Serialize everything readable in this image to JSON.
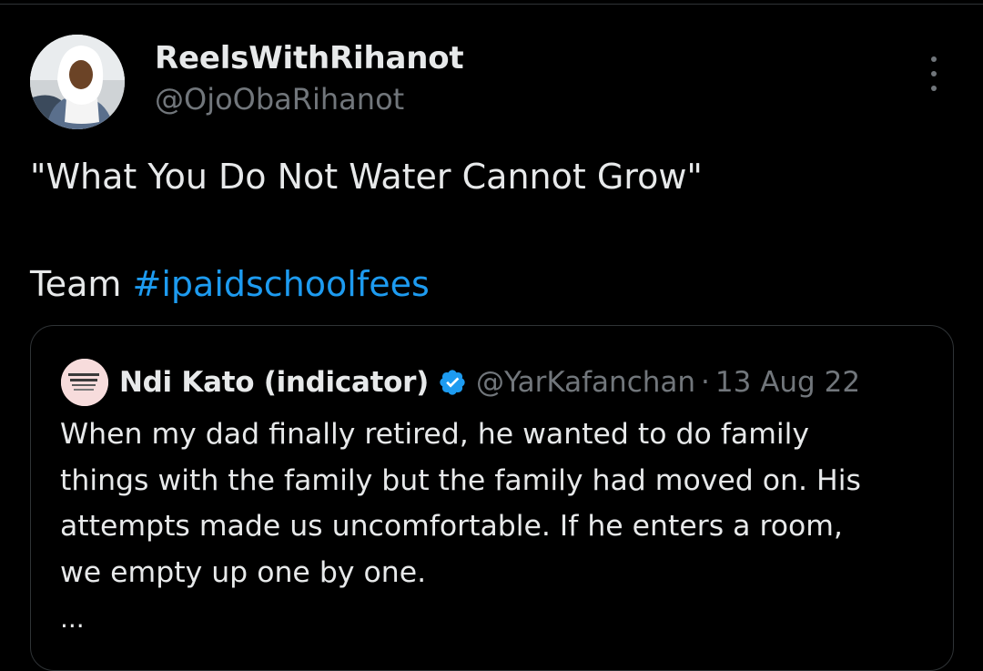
{
  "tweet": {
    "author": {
      "display_name": "ReelsWithRihanot",
      "handle": "@OjoObaRihanot",
      "avatar_icon": "profile-photo"
    },
    "text_line1": "\"What You Do Not Water Cannot Grow\"",
    "text_line2_prefix": "Team ",
    "hashtag": "#ipaidschoolfees",
    "more_icon": "more-vertical-icon"
  },
  "quote": {
    "display_name": "Ndi Kato (indicator)",
    "verified_icon": "verified-badge-icon",
    "handle": "@YarKafanchan",
    "separator": "·",
    "date": "13 Aug 22",
    "lines": [
      "When my dad finally retired, he wanted to do family",
      "things with the family but the family had moved on. His",
      "attempts made us uncomfortable. If he enters a room,",
      "we empty up one by one."
    ],
    "ellipsis": "..."
  },
  "colors": {
    "background": "#000000",
    "text": "#e7e9ea",
    "muted": "#71767b",
    "link": "#1d9bf0",
    "border": "#2f3336"
  }
}
